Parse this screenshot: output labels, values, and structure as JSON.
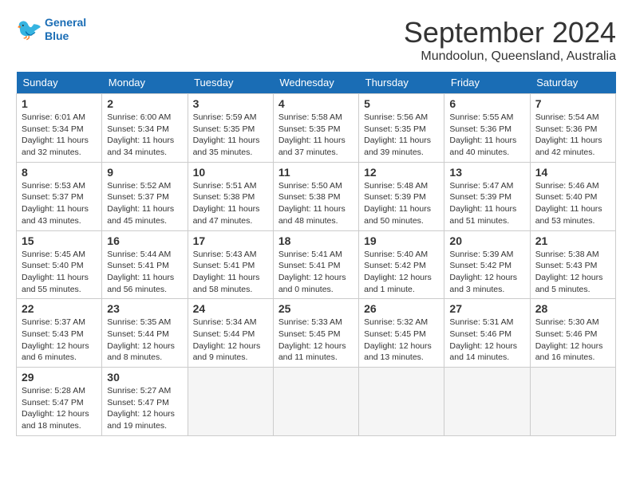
{
  "header": {
    "logo_line1": "General",
    "logo_line2": "Blue",
    "month_title": "September 2024",
    "location": "Mundoolun, Queensland, Australia"
  },
  "days_of_week": [
    "Sunday",
    "Monday",
    "Tuesday",
    "Wednesday",
    "Thursday",
    "Friday",
    "Saturday"
  ],
  "weeks": [
    [
      {
        "day": "1",
        "info": "Sunrise: 6:01 AM\nSunset: 5:34 PM\nDaylight: 11 hours\nand 32 minutes."
      },
      {
        "day": "2",
        "info": "Sunrise: 6:00 AM\nSunset: 5:34 PM\nDaylight: 11 hours\nand 34 minutes."
      },
      {
        "day": "3",
        "info": "Sunrise: 5:59 AM\nSunset: 5:35 PM\nDaylight: 11 hours\nand 35 minutes."
      },
      {
        "day": "4",
        "info": "Sunrise: 5:58 AM\nSunset: 5:35 PM\nDaylight: 11 hours\nand 37 minutes."
      },
      {
        "day": "5",
        "info": "Sunrise: 5:56 AM\nSunset: 5:35 PM\nDaylight: 11 hours\nand 39 minutes."
      },
      {
        "day": "6",
        "info": "Sunrise: 5:55 AM\nSunset: 5:36 PM\nDaylight: 11 hours\nand 40 minutes."
      },
      {
        "day": "7",
        "info": "Sunrise: 5:54 AM\nSunset: 5:36 PM\nDaylight: 11 hours\nand 42 minutes."
      }
    ],
    [
      {
        "day": "8",
        "info": "Sunrise: 5:53 AM\nSunset: 5:37 PM\nDaylight: 11 hours\nand 43 minutes."
      },
      {
        "day": "9",
        "info": "Sunrise: 5:52 AM\nSunset: 5:37 PM\nDaylight: 11 hours\nand 45 minutes."
      },
      {
        "day": "10",
        "info": "Sunrise: 5:51 AM\nSunset: 5:38 PM\nDaylight: 11 hours\nand 47 minutes."
      },
      {
        "day": "11",
        "info": "Sunrise: 5:50 AM\nSunset: 5:38 PM\nDaylight: 11 hours\nand 48 minutes."
      },
      {
        "day": "12",
        "info": "Sunrise: 5:48 AM\nSunset: 5:39 PM\nDaylight: 11 hours\nand 50 minutes."
      },
      {
        "day": "13",
        "info": "Sunrise: 5:47 AM\nSunset: 5:39 PM\nDaylight: 11 hours\nand 51 minutes."
      },
      {
        "day": "14",
        "info": "Sunrise: 5:46 AM\nSunset: 5:40 PM\nDaylight: 11 hours\nand 53 minutes."
      }
    ],
    [
      {
        "day": "15",
        "info": "Sunrise: 5:45 AM\nSunset: 5:40 PM\nDaylight: 11 hours\nand 55 minutes."
      },
      {
        "day": "16",
        "info": "Sunrise: 5:44 AM\nSunset: 5:41 PM\nDaylight: 11 hours\nand 56 minutes."
      },
      {
        "day": "17",
        "info": "Sunrise: 5:43 AM\nSunset: 5:41 PM\nDaylight: 11 hours\nand 58 minutes."
      },
      {
        "day": "18",
        "info": "Sunrise: 5:41 AM\nSunset: 5:41 PM\nDaylight: 12 hours\nand 0 minutes."
      },
      {
        "day": "19",
        "info": "Sunrise: 5:40 AM\nSunset: 5:42 PM\nDaylight: 12 hours\nand 1 minute."
      },
      {
        "day": "20",
        "info": "Sunrise: 5:39 AM\nSunset: 5:42 PM\nDaylight: 12 hours\nand 3 minutes."
      },
      {
        "day": "21",
        "info": "Sunrise: 5:38 AM\nSunset: 5:43 PM\nDaylight: 12 hours\nand 5 minutes."
      }
    ],
    [
      {
        "day": "22",
        "info": "Sunrise: 5:37 AM\nSunset: 5:43 PM\nDaylight: 12 hours\nand 6 minutes."
      },
      {
        "day": "23",
        "info": "Sunrise: 5:35 AM\nSunset: 5:44 PM\nDaylight: 12 hours\nand 8 minutes."
      },
      {
        "day": "24",
        "info": "Sunrise: 5:34 AM\nSunset: 5:44 PM\nDaylight: 12 hours\nand 9 minutes."
      },
      {
        "day": "25",
        "info": "Sunrise: 5:33 AM\nSunset: 5:45 PM\nDaylight: 12 hours\nand 11 minutes."
      },
      {
        "day": "26",
        "info": "Sunrise: 5:32 AM\nSunset: 5:45 PM\nDaylight: 12 hours\nand 13 minutes."
      },
      {
        "day": "27",
        "info": "Sunrise: 5:31 AM\nSunset: 5:46 PM\nDaylight: 12 hours\nand 14 minutes."
      },
      {
        "day": "28",
        "info": "Sunrise: 5:30 AM\nSunset: 5:46 PM\nDaylight: 12 hours\nand 16 minutes."
      }
    ],
    [
      {
        "day": "29",
        "info": "Sunrise: 5:28 AM\nSunset: 5:47 PM\nDaylight: 12 hours\nand 18 minutes."
      },
      {
        "day": "30",
        "info": "Sunrise: 5:27 AM\nSunset: 5:47 PM\nDaylight: 12 hours\nand 19 minutes."
      },
      {
        "day": "",
        "info": ""
      },
      {
        "day": "",
        "info": ""
      },
      {
        "day": "",
        "info": ""
      },
      {
        "day": "",
        "info": ""
      },
      {
        "day": "",
        "info": ""
      }
    ]
  ]
}
